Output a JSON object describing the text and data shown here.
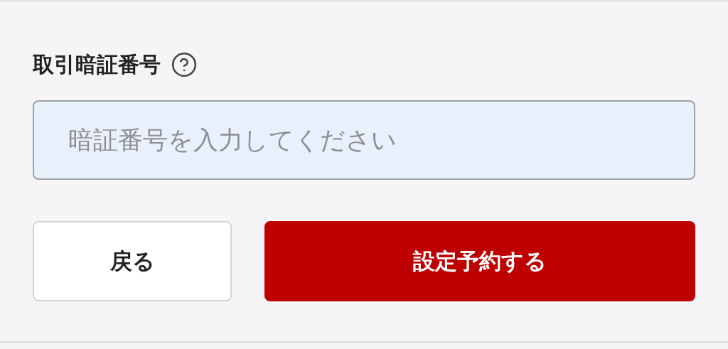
{
  "field": {
    "label": "取引暗証番号",
    "placeholder": "暗証番号を入力してください"
  },
  "buttons": [
    {
      "label": "戻る",
      "kind": "secondary"
    },
    {
      "label": "設定予約する",
      "kind": "primary"
    }
  ]
}
